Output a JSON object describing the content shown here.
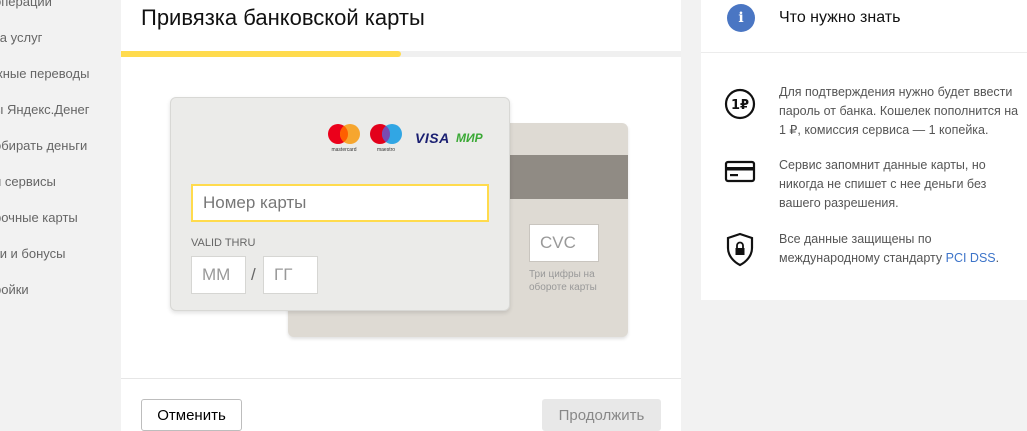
{
  "sidebar": {
    "items": [
      {
        "label": "операции"
      },
      {
        "label": "та услуг"
      },
      {
        "label": "жные переводы"
      },
      {
        "label": "ы Яндекс.Денег"
      },
      {
        "label": "обирать деньги"
      },
      {
        "label": "и сервисы"
      },
      {
        "label": "рочные карты"
      },
      {
        "label": "ки и бонусы"
      },
      {
        "label": "ройки"
      }
    ]
  },
  "main": {
    "title": "Привязка банковской карты",
    "progress_fraction": 0.5,
    "card": {
      "brands": {
        "mastercard": "mastercard",
        "maestro": "maestro",
        "visa": "VISA",
        "mir": "МИР"
      },
      "number_placeholder": "Номер карты",
      "valid_thru_label": "VALID THRU",
      "month_placeholder": "ММ",
      "separator": "/",
      "year_placeholder": "ГГ",
      "cvc_placeholder": "CVC",
      "cvc_hint": "Три цифры на обороте карты"
    },
    "buttons": {
      "cancel": "Отменить",
      "continue": "Продолжить"
    }
  },
  "info": {
    "title": "Что нужно знать",
    "items": [
      {
        "icon": "ruble-circle-icon",
        "text": "Для подтверждения нужно будет ввести пароль от банка. Кошелек пополнится на 1 ₽, комиссия сервиса — 1 копейка."
      },
      {
        "icon": "credit-card-icon",
        "text": "Сервис запомнит данные карты, но никогда не спишет с нее деньги без вашего разрешения."
      },
      {
        "icon": "shield-lock-icon",
        "text_before": "Все данные защищены по международному стандарту ",
        "link": "PCI DSS",
        "text_after": "."
      }
    ]
  },
  "colors": {
    "accent": "#ffdb4d",
    "link": "#3d74c9",
    "info_icon": "#4a76c3"
  }
}
